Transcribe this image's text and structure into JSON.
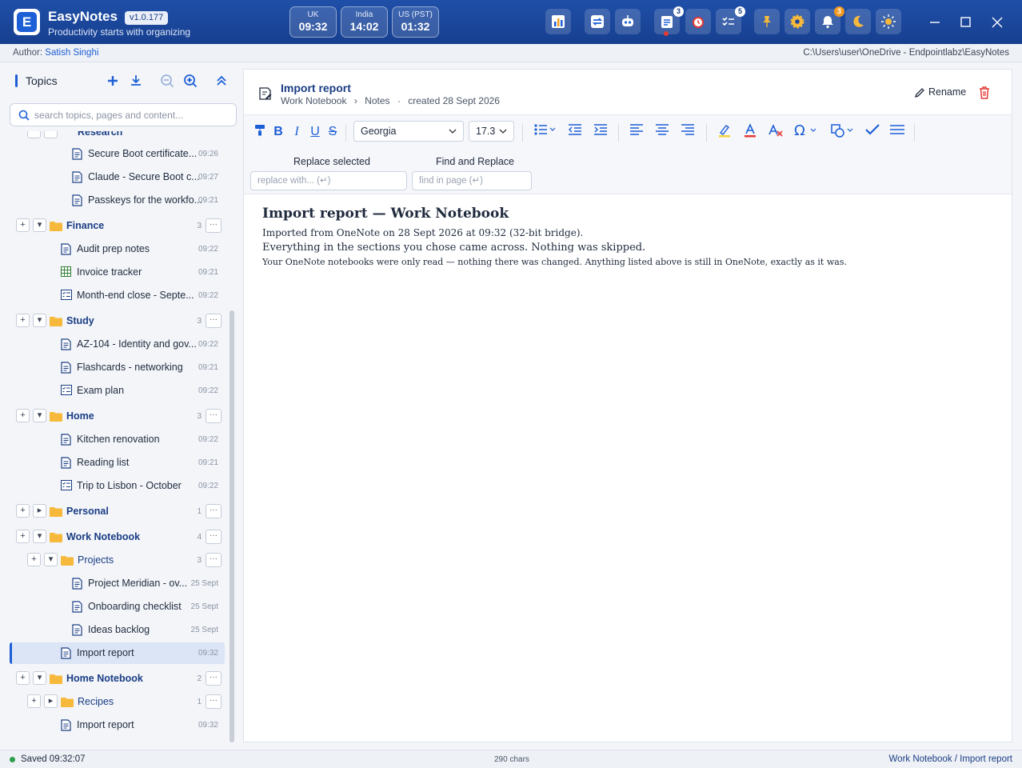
{
  "app": {
    "name": "EasyNotes",
    "version": "v1.0.177",
    "tagline": "Productivity starts with organizing",
    "logo_letter": "E"
  },
  "clocks": [
    {
      "label": "UK",
      "time": "09:32"
    },
    {
      "label": "India",
      "time": "14:02"
    },
    {
      "label": "US (PST)",
      "time": "01:32"
    }
  ],
  "toolbar_badges": {
    "tasks": "3",
    "checklist": "5",
    "notifications": "3"
  },
  "author": {
    "label": "Author:",
    "name": "Satish Singhi"
  },
  "path": "C:\\Users\\user\\OneDrive - Endpointlabz\\EasyNotes",
  "sidebar": {
    "title": "Topics",
    "search_placeholder": "search topics, pages and content...",
    "partial_label": "Research",
    "rows": [
      {
        "label": "Secure Boot certificate...",
        "meta": "09:26"
      },
      {
        "label": "Claude - Secure Boot c...",
        "meta": "09:27"
      },
      {
        "label": "Passkeys for the workfo...",
        "meta": "09:21"
      },
      {
        "label": "Finance",
        "count": "3"
      },
      {
        "label": "Audit prep notes",
        "meta": "09:22"
      },
      {
        "label": "Invoice tracker",
        "meta": "09:21"
      },
      {
        "label": "Month-end close - Septe...",
        "meta": "09:22"
      },
      {
        "label": "Study",
        "count": "3"
      },
      {
        "label": "AZ-104 - Identity and gov...",
        "meta": "09:22"
      },
      {
        "label": "Flashcards - networking",
        "meta": "09:21"
      },
      {
        "label": "Exam plan",
        "meta": "09:22"
      },
      {
        "label": "Home",
        "count": "3"
      },
      {
        "label": "Kitchen renovation",
        "meta": "09:22"
      },
      {
        "label": "Reading list",
        "meta": "09:21"
      },
      {
        "label": "Trip to Lisbon - October",
        "meta": "09:22"
      },
      {
        "label": "Personal",
        "count": "1"
      },
      {
        "label": "Work Notebook",
        "count": "4"
      },
      {
        "label": "Projects",
        "count": "3"
      },
      {
        "label": "Project Meridian - ov...",
        "meta": "25 Sept"
      },
      {
        "label": "Onboarding checklist",
        "meta": "25 Sept"
      },
      {
        "label": "Ideas backlog",
        "meta": "25 Sept"
      },
      {
        "label": "Import report",
        "meta": "09:32"
      },
      {
        "label": "Home Notebook",
        "count": "2"
      },
      {
        "label": "Recipes",
        "count": "1"
      },
      {
        "label": "Import report",
        "meta": "09:32"
      }
    ]
  },
  "page": {
    "title": "Import report",
    "breadcrumb": [
      "Work Notebook",
      "›",
      "Notes",
      "·",
      "created 28 Sept 2026"
    ],
    "rename_label": "Rename"
  },
  "editor": {
    "font_family": "Georgia",
    "font_size": "17.3",
    "replace_label": "Replace selected",
    "replace_placeholder": "replace with... (↵)",
    "find_label": "Find and Replace",
    "find_placeholder": "find in page (↵)"
  },
  "content": {
    "heading": "Import report — Work Notebook",
    "p1": "Imported from OneNote on 28 Sept 2026 at 09:32 (32-bit bridge).",
    "p2": "Everything in the sections you chose came across. Nothing was skipped.",
    "p3": "Your OneNote notebooks were only read — nothing there was changed. Anything listed above is still in OneNote, exactly as it was."
  },
  "status": {
    "saved": "Saved 09:32:07",
    "chars": "290 chars",
    "breadcrumb": "Work Notebook / Import report"
  },
  "colors": {
    "accent": "#1d5fd6",
    "titlebar": "#1a4699",
    "folder": "#f6b93b"
  }
}
